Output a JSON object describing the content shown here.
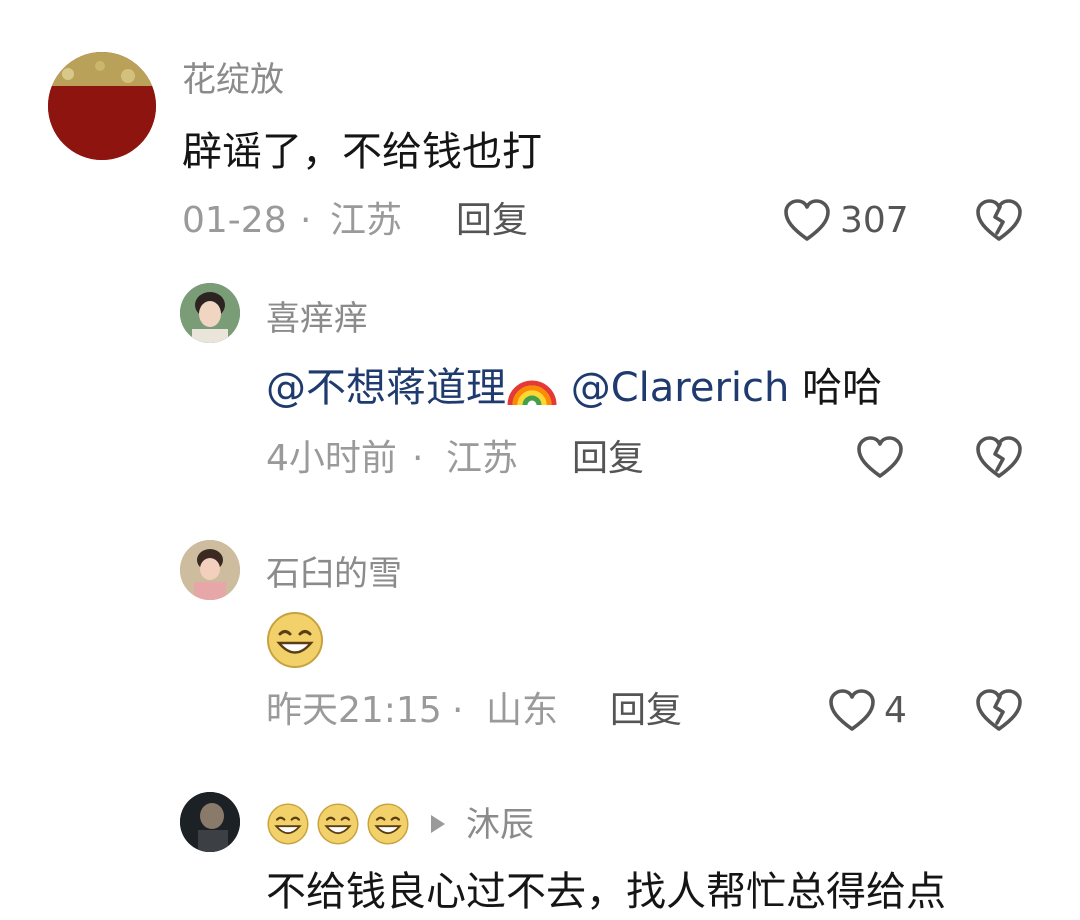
{
  "comments": [
    {
      "user": "花绽放",
      "text": "辟谣了，不给钱也打",
      "time": "01-28",
      "sep": "·",
      "location": "江苏",
      "reply_label": "回复",
      "likes": "307",
      "avatar_icon": "red-flower-avatar"
    },
    {
      "user": "喜痒痒",
      "mention1": "@不想蒋道理",
      "mention1_emoji": "rainbow-icon",
      "mention2": "@Clarerich",
      "text_tail": "哈哈",
      "time": "4小时前",
      "sep": "·",
      "location": "江苏",
      "reply_label": "回复",
      "avatar_icon": "boy-avatar"
    },
    {
      "user": "石臼的雪",
      "emoji": "grin-emoji",
      "time": "昨天21:15",
      "sep": "·",
      "location": "山东",
      "reply_label": "回复",
      "likes": "4",
      "avatar_icon": "girl-avatar"
    },
    {
      "user": "沐辰",
      "name_prefix_emojis": [
        "smile-emoji",
        "smile-emoji",
        "smile-emoji"
      ],
      "reply_to_arrow": "play-triangle-icon",
      "text": "不给钱良心过不去，找人帮忙总得给点",
      "avatar_icon": "dark-photo-avatar"
    }
  ],
  "colors": {
    "name": "#8b8b8b",
    "text": "#151515",
    "meta": "#9a9a9a",
    "mention": "#1e3a6e",
    "icon": "#555555"
  }
}
